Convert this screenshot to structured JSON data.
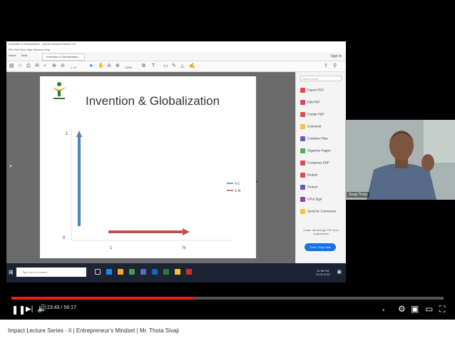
{
  "acrobat": {
    "title_bar": "Invention & Globalization - Adobe Acrobat Reader DC",
    "menu": "File  Edit  View  Sign  Window  Help",
    "tabs": [
      "Home",
      "Tools",
      "Invention & Globalization..."
    ],
    "sign_in": "Sign In",
    "page_indicator": "1 / 8",
    "zoom": "100%"
  },
  "slide": {
    "title": "Invention & Globalization",
    "y_tick_top": "1",
    "y_tick_bottom": "0",
    "x_tick_left": "1",
    "x_tick_right": "N",
    "legend": [
      "0-1",
      "1-N"
    ],
    "colors": {
      "series_0_1": "#4f81bd",
      "series_1_n": "#c0504d"
    }
  },
  "chart_data": {
    "type": "bar",
    "title": "",
    "series": [
      {
        "name": "0-1",
        "orientation": "vertical",
        "from": 0,
        "to": 1
      },
      {
        "name": "1-N",
        "orientation": "horizontal",
        "from": 1,
        "to": "N"
      }
    ],
    "x_ticks": [
      "1",
      "N"
    ],
    "y_ticks": [
      "0",
      "1"
    ],
    "legend_position": "right"
  },
  "right_panel": {
    "search_placeholder": "Search tools",
    "items": [
      {
        "label": "Export PDF",
        "icon": "export-pdf-icon",
        "color": "#e34850"
      },
      {
        "label": "Edit PDF",
        "icon": "edit-pdf-icon",
        "color": "#e34850"
      },
      {
        "label": "Create PDF",
        "icon": "create-pdf-icon",
        "color": "#e34850"
      },
      {
        "label": "Comment",
        "icon": "comment-icon",
        "color": "#f6c244"
      },
      {
        "label": "Combine Files",
        "icon": "combine-files-icon",
        "color": "#6d55d1"
      },
      {
        "label": "Organize Pages",
        "icon": "organize-pages-icon",
        "color": "#4caf50"
      },
      {
        "label": "Compress PDF",
        "icon": "compress-pdf-icon",
        "color": "#e34850"
      },
      {
        "label": "Redact",
        "icon": "redact-icon",
        "color": "#e34850"
      },
      {
        "label": "Protect",
        "icon": "protect-icon",
        "color": "#6d55d1"
      },
      {
        "label": "Fill & Sign",
        "icon": "fill-sign-icon",
        "color": "#8e44ad"
      },
      {
        "label": "Send for Comments",
        "icon": "send-comments-icon",
        "color": "#f6c244"
      }
    ],
    "note": "Create, edit and sign PDF forms & agreements",
    "trial_button": "Free 7-Day Trial"
  },
  "taskbar": {
    "search_placeholder": "Type here to search",
    "time": "12:58 PM",
    "date": "14-06-2021"
  },
  "webcam": {
    "name": "Sivaji Thota"
  },
  "player": {
    "time": "23:43 / 56:17",
    "progress_fraction": 0.42,
    "colors": {
      "progress": "#e62117"
    }
  },
  "video": {
    "title": "Impact Lecture Series - II | Entrepreneur's Mindset | Mr. Thota Sivaji"
  }
}
